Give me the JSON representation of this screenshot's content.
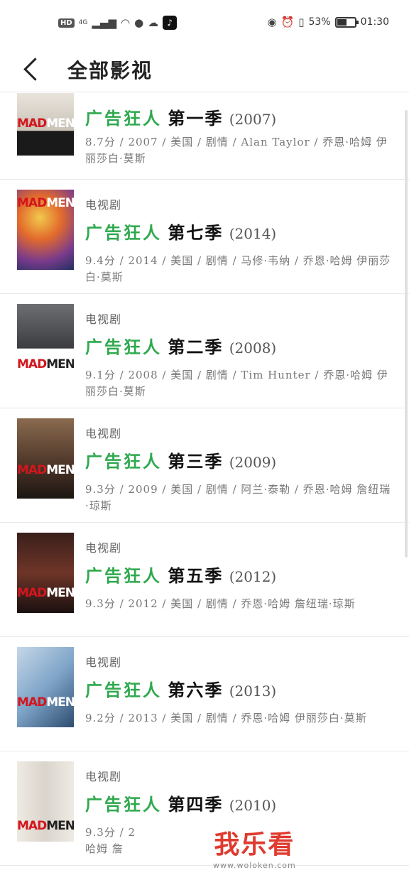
{
  "status_bar": {
    "hd": "HD",
    "network": "4G",
    "battery": "53%",
    "time": "01:30"
  },
  "header": {
    "title": "全部影视",
    "back_icon": "chevron-left-icon"
  },
  "items": [
    {
      "category": "",
      "title": "广告狂人",
      "season": "第一季",
      "year": "(2007)",
      "meta": "8.7分 / 2007 / 美国 / 剧情 / Alan Taylor / 乔恩·哈姆 伊丽莎白·莫斯",
      "poster_color": "#e9e4dc"
    },
    {
      "category": "电视剧",
      "title": "广告狂人",
      "season": "第七季",
      "year": "(2014)",
      "meta": "9.4分 / 2014 / 美国 / 剧情 / 马修·韦纳 / 乔恩·哈姆 伊丽莎白·莫斯",
      "poster_color": "#c86a2c"
    },
    {
      "category": "电视剧",
      "title": "广告狂人",
      "season": "第二季",
      "year": "(2008)",
      "meta": "9.1分 / 2008 / 美国 / 剧情 / Tim Hunter / 乔恩·哈姆 伊丽莎白·莫斯",
      "poster_color": "#3b3d40"
    },
    {
      "category": "电视剧",
      "title": "广告狂人",
      "season": "第三季",
      "year": "(2009)",
      "meta": "9.3分 / 2009 / 美国 / 剧情 / 阿兰·泰勒 / 乔恩·哈姆 詹纽瑞·琼斯",
      "poster_color": "#6b4a35"
    },
    {
      "category": "电视剧",
      "title": "广告狂人",
      "season": "第五季",
      "year": "(2012)",
      "meta": "9.3分 / 2012 / 美国 / 剧情 / 乔恩·哈姆 詹纽瑞·琼斯",
      "poster_color": "#5a2a22"
    },
    {
      "category": "电视剧",
      "title": "广告狂人",
      "season": "第六季",
      "year": "(2013)",
      "meta": "9.2分 / 2013 / 美国 / 剧情 / 乔恩·哈姆 伊丽莎白·莫斯",
      "poster_color": "#7fa5c8"
    },
    {
      "category": "电视剧",
      "title": "广告狂人",
      "season": "第四季",
      "year": "(2010)",
      "meta": "9.3分 / 2",
      "meta2": "哈姆 詹",
      "poster_color": "#d9d4cc"
    }
  ],
  "watermark": {
    "main": "我乐看",
    "url": "www.woloken.com"
  },
  "colors": {
    "title_green": "#2fa94e",
    "poster_red": "#d3161e"
  }
}
